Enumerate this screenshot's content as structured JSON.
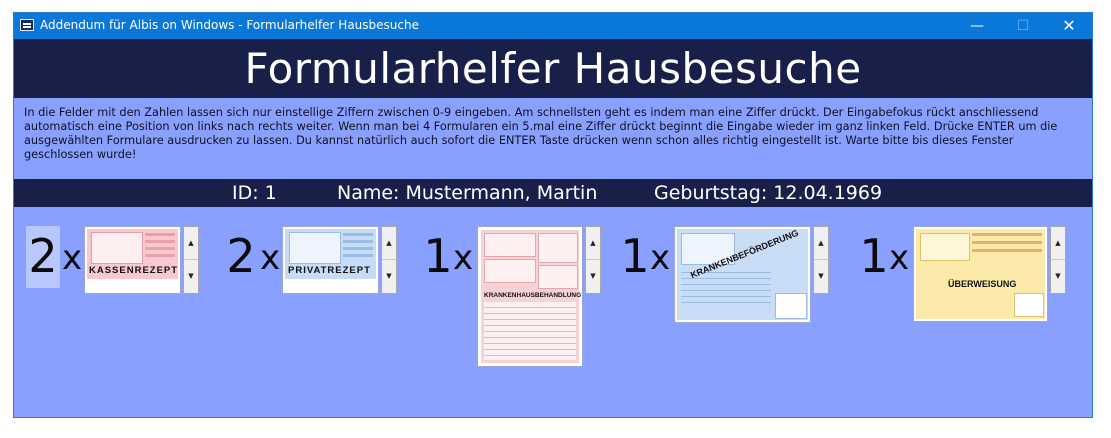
{
  "window": {
    "title": "Addendum für Albis on Windows - Formularhelfer Hausbesuche",
    "controls": {
      "minimize": "—",
      "maximize": "☐",
      "close": "✕"
    }
  },
  "header": {
    "title": "Formularhelfer Hausbesuche"
  },
  "instructions": "In die Felder mit den Zahlen lassen sich nur einstellige Ziffern zwischen 0-9 eingeben. Am schnellsten geht es indem man eine Ziffer drückt. Der Eingabefokus rückt anschliessend automatisch eine Position von links nach rechts weiter. Wenn man bei 4 Formularen ein 5.mal eine Ziffer drückt beginnt die Eingabe wieder im ganz linken Feld. Drücke ENTER um die ausgewählten Formulare ausdrucken zu lassen. Du kannst natürlich auch sofort die ENTER Taste drücken wenn schon alles richtig eingestellt ist. Warte bitte bis dieses Fenster geschlossen wurde!",
  "patient": {
    "id": "ID: 1",
    "name": "Name: Mustermann, Martin",
    "birthday": "Geburtstag: 12.04.1969"
  },
  "multiplier": "x",
  "forms": [
    {
      "count": "2",
      "label": "KASSENREZEPT",
      "color": "#f5c4cc"
    },
    {
      "count": "2",
      "label": "PRIVATREZEPT",
      "color": "#c4daf5"
    },
    {
      "count": "1",
      "label": "KRANKENHAUSBEHANDLUNG",
      "color": "#f7cfd2"
    },
    {
      "count": "1",
      "label": "KRANKENBEFÖRDERUNG",
      "color": "#c8dcf7"
    },
    {
      "count": "1",
      "label": "ÜBERWEISUNG",
      "color": "#fbe9a8"
    }
  ],
  "spinner": {
    "up": "▲",
    "down": "▼"
  }
}
